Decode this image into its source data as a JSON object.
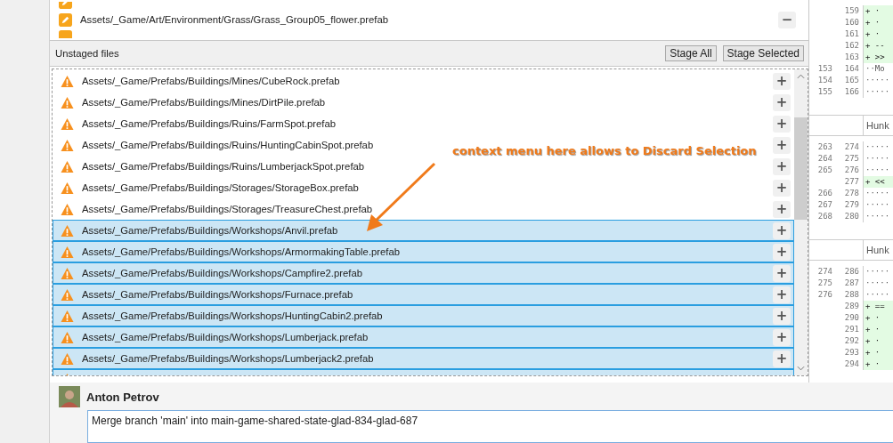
{
  "staged_files": [
    {
      "path": "Assets/_Game/Art/Environment/Grass/Grass_Group05_flower.prefab",
      "action": "−"
    }
  ],
  "unstaged": {
    "title": "Unstaged files",
    "buttons": [
      "Stage All",
      "Stage Selected"
    ],
    "files": [
      {
        "path": "Assets/_Game/Prefabs/Buildings/Mines/CubeRock.prefab",
        "selected": false,
        "action": "+"
      },
      {
        "path": "Assets/_Game/Prefabs/Buildings/Mines/DirtPile.prefab",
        "selected": false,
        "action": "+"
      },
      {
        "path": "Assets/_Game/Prefabs/Buildings/Ruins/FarmSpot.prefab",
        "selected": false,
        "action": "+"
      },
      {
        "path": "Assets/_Game/Prefabs/Buildings/Ruins/HuntingCabinSpot.prefab",
        "selected": false,
        "action": "+"
      },
      {
        "path": "Assets/_Game/Prefabs/Buildings/Ruins/LumberjackSpot.prefab",
        "selected": false,
        "action": "+"
      },
      {
        "path": "Assets/_Game/Prefabs/Buildings/Storages/StorageBox.prefab",
        "selected": false,
        "action": "+"
      },
      {
        "path": "Assets/_Game/Prefabs/Buildings/Storages/TreasureChest.prefab",
        "selected": false,
        "action": "+"
      },
      {
        "path": "Assets/_Game/Prefabs/Buildings/Workshops/Anvil.prefab",
        "selected": true,
        "action": "+"
      },
      {
        "path": "Assets/_Game/Prefabs/Buildings/Workshops/ArmormakingTable.prefab",
        "selected": true,
        "action": "+"
      },
      {
        "path": "Assets/_Game/Prefabs/Buildings/Workshops/Campfire2.prefab",
        "selected": true,
        "action": "+"
      },
      {
        "path": "Assets/_Game/Prefabs/Buildings/Workshops/Furnace.prefab",
        "selected": true,
        "action": "+"
      },
      {
        "path": "Assets/_Game/Prefabs/Buildings/Workshops/HuntingCabin2.prefab",
        "selected": true,
        "action": "+"
      },
      {
        "path": "Assets/_Game/Prefabs/Buildings/Workshops/Lumberjack.prefab",
        "selected": true,
        "action": "+"
      },
      {
        "path": "Assets/_Game/Prefabs/Buildings/Workshops/Lumberjack2.prefab",
        "selected": true,
        "action": "+"
      }
    ]
  },
  "annotation": "context menu here allows to Discard Selection",
  "diff": [
    {
      "kind": "line",
      "new": "159",
      "added": true,
      "text": "+ ·"
    },
    {
      "kind": "line",
      "new": "160",
      "added": true,
      "text": "+ ·"
    },
    {
      "kind": "line",
      "new": "161",
      "added": true,
      "text": "+ ·"
    },
    {
      "kind": "line",
      "new": "162",
      "added": true,
      "text": "+ --"
    },
    {
      "kind": "line",
      "new": "163",
      "added": true,
      "text": "+ >>"
    },
    {
      "kind": "line",
      "old": "153",
      "new": "164",
      "added": false,
      "text": "··Mo"
    },
    {
      "kind": "line",
      "old": "154",
      "new": "165",
      "added": false,
      "text": "·····"
    },
    {
      "kind": "line",
      "old": "155",
      "new": "166",
      "added": false,
      "text": "·····"
    },
    {
      "kind": "hunk",
      "text": "Hunk"
    },
    {
      "kind": "line",
      "old": "263",
      "new": "274",
      "added": false,
      "text": "·····"
    },
    {
      "kind": "line",
      "old": "264",
      "new": "275",
      "added": false,
      "text": "·····"
    },
    {
      "kind": "line",
      "old": "265",
      "new": "276",
      "added": false,
      "text": "·····"
    },
    {
      "kind": "line",
      "new": "277",
      "added": true,
      "text": "+ <<"
    },
    {
      "kind": "line",
      "old": "266",
      "new": "278",
      "added": false,
      "text": "·····"
    },
    {
      "kind": "line",
      "old": "267",
      "new": "279",
      "added": false,
      "text": "·····"
    },
    {
      "kind": "line",
      "old": "268",
      "new": "280",
      "added": false,
      "text": "·····"
    },
    {
      "kind": "hunk",
      "text": "Hunk"
    },
    {
      "kind": "line",
      "old": "274",
      "new": "286",
      "added": false,
      "text": "·····"
    },
    {
      "kind": "line",
      "old": "275",
      "new": "287",
      "added": false,
      "text": "·····"
    },
    {
      "kind": "line",
      "old": "276",
      "new": "288",
      "added": false,
      "text": "·····"
    },
    {
      "kind": "line",
      "new": "289",
      "added": true,
      "text": "+ =="
    },
    {
      "kind": "line",
      "new": "290",
      "added": true,
      "text": "+ ·"
    },
    {
      "kind": "line",
      "new": "291",
      "added": true,
      "text": "+ ·"
    },
    {
      "kind": "line",
      "new": "292",
      "added": true,
      "text": "+ ·"
    },
    {
      "kind": "line",
      "new": "293",
      "added": true,
      "text": "+ ·"
    },
    {
      "kind": "line",
      "new": "294",
      "added": true,
      "text": "+ ·"
    }
  ],
  "commit": {
    "author": "Anton Petrov",
    "message": "Merge branch 'main' into main-game-shared-state-glad-834-glad-687"
  }
}
